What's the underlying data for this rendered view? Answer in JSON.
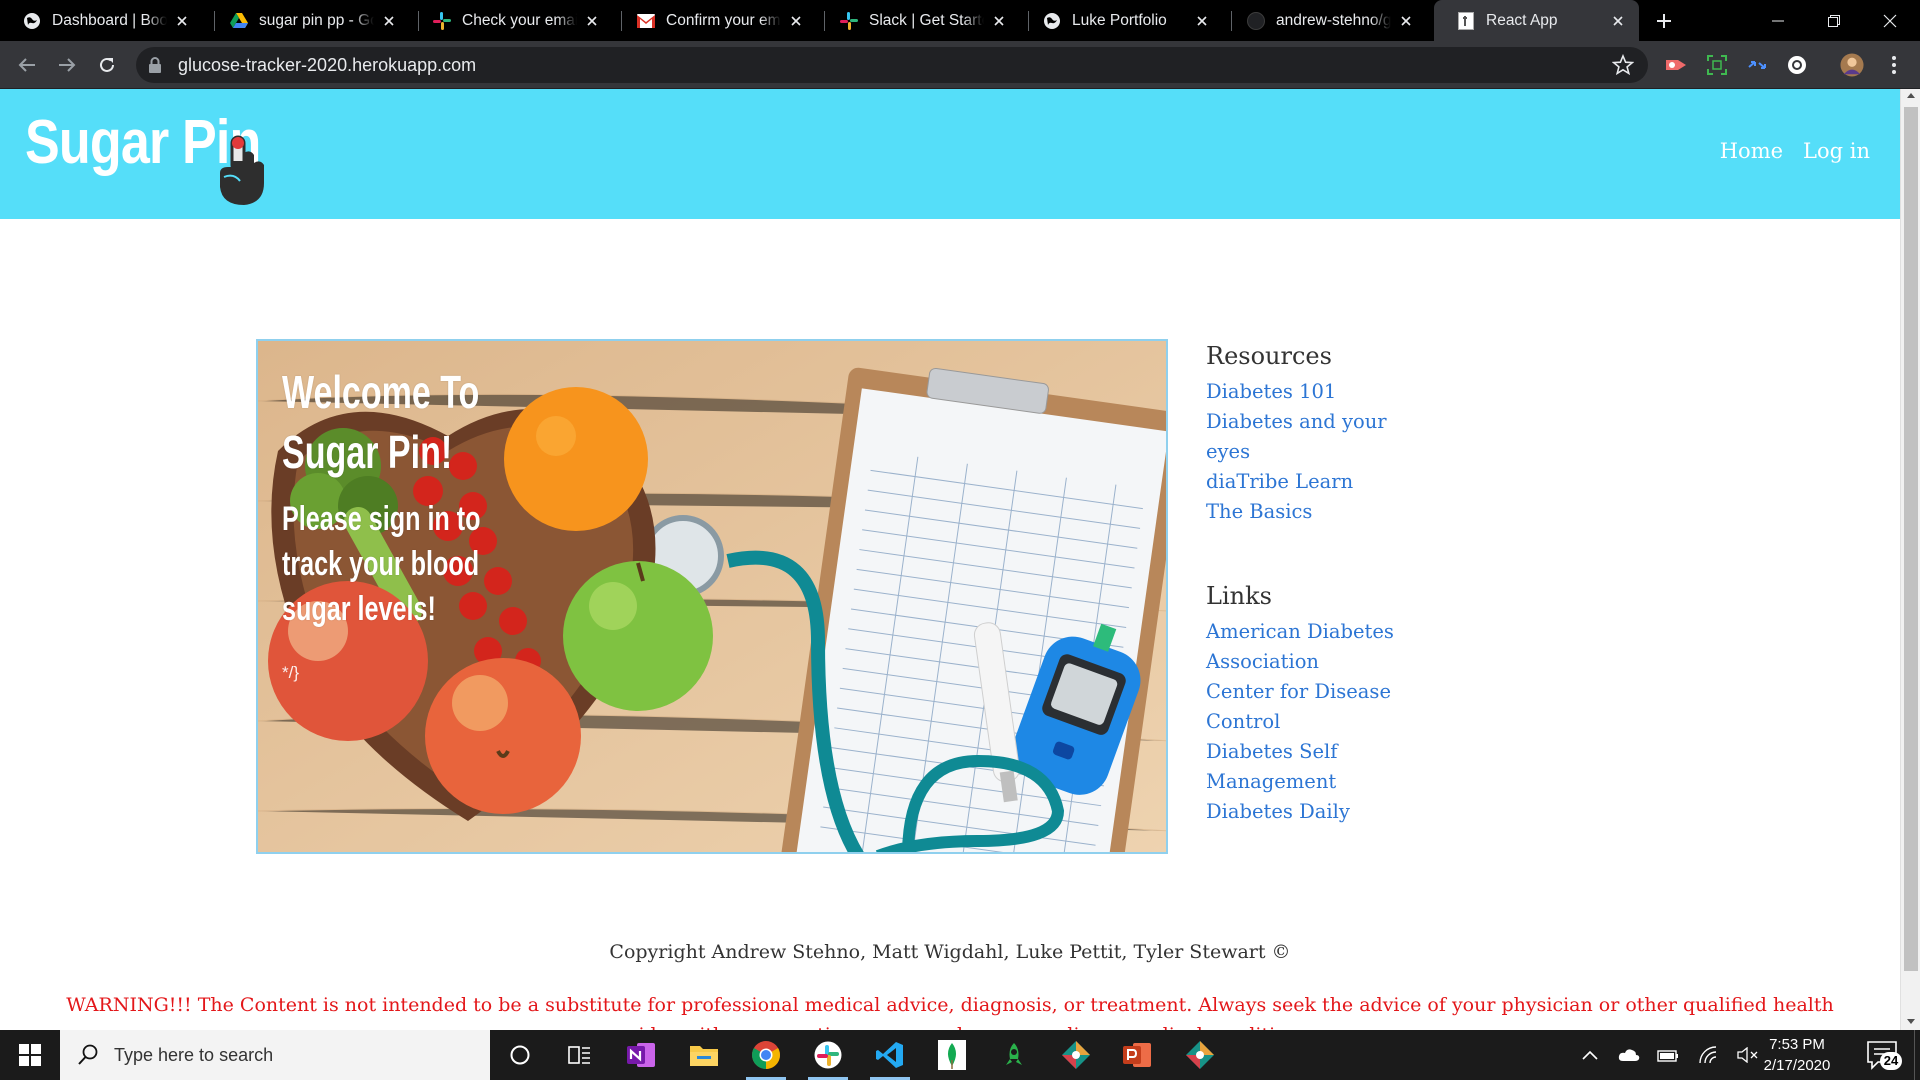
{
  "browser": {
    "tabs": [
      {
        "title": "Dashboard | Bootcamp",
        "favicon": "globe-icon"
      },
      {
        "title": "sugar pin pp - Google Drive",
        "favicon": "google-drive-icon"
      },
      {
        "title": "Check your email!",
        "favicon": "slack-icon"
      },
      {
        "title": "Confirm your email",
        "favicon": "gmail-icon"
      },
      {
        "title": "Slack | Get Started",
        "favicon": "slack-icon"
      },
      {
        "title": "Luke Portfolio",
        "favicon": "globe-icon"
      },
      {
        "title": "andrew-stehno/glucose-tracker",
        "favicon": "github-icon"
      },
      {
        "title": "React App",
        "favicon": "document-icon",
        "active": true
      }
    ],
    "url": "glucose-tracker-2020.herokuapp.com"
  },
  "site": {
    "logo": "Sugar Pin",
    "nav": {
      "home": "Home",
      "login": "Log in"
    },
    "hero": {
      "title_line1": "Welcome To",
      "title_line2": "Sugar Pin!",
      "sub_line1": "Please sign in to",
      "sub_line2": "track your blood",
      "sub_line3": "sugar levels!",
      "stray_comment": "*/}"
    },
    "resources": {
      "heading": "Resources",
      "items": [
        "Diabetes 101",
        "Diabetes and your",
        "eyes",
        "diaTribe Learn",
        "The Basics"
      ]
    },
    "links": {
      "heading": "Links",
      "items": [
        "American Diabetes",
        "Association",
        "Center for Disease",
        "Control",
        "Diabetes Self",
        "Management",
        "Diabetes Daily"
      ]
    },
    "copyright": "Copyright Andrew Stehno, Matt Wigdahl, Luke Pettit, Tyler Stewart ©",
    "warning": "WARNING!!! The Content is not intended to be a substitute for professional medical advice, diagnosis, or treatment. Always seek the advice of your physician or other qualified health provider with any questions you may have regarding a medical condition."
  },
  "taskbar": {
    "search_placeholder": "Type here to search",
    "time": "7:53 PM",
    "date": "2/17/2020",
    "notifications": "24",
    "apps": [
      "task-view-icon",
      "onenote-icon",
      "file-explorer-icon",
      "chrome-icon",
      "slack-icon",
      "vscode-icon",
      "mongodb-icon",
      "robo3t-icon",
      "gitkraken-icon",
      "powerpoint-icon",
      "gitkraken-icon"
    ]
  },
  "colors": {
    "header": "#55def9",
    "link": "#2c75d4",
    "warning": "#e3171a"
  }
}
